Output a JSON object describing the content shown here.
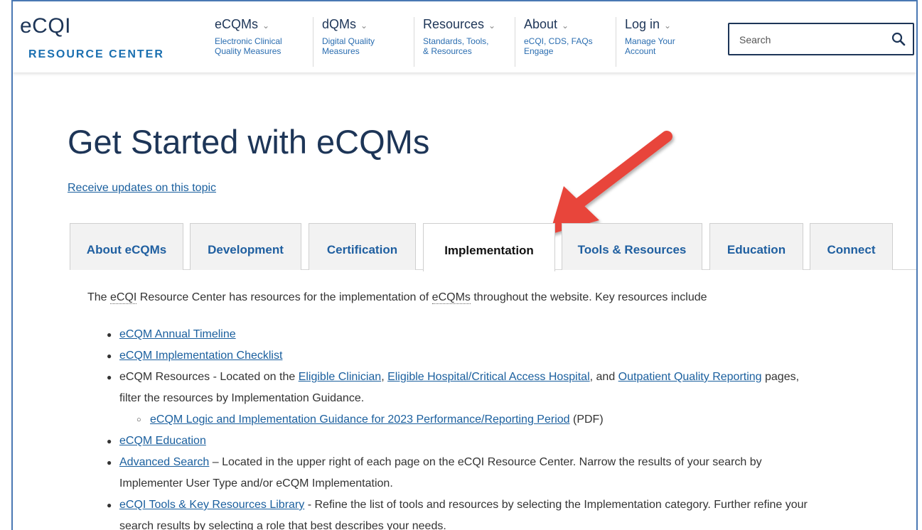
{
  "logo": {
    "top": "eCQI",
    "bottom": "RESOURCE CENTER"
  },
  "nav": [
    {
      "label": "eCQMs",
      "sub": "Electronic Clinical\nQuality Measures"
    },
    {
      "label": "dQMs",
      "sub": "Digital Quality\nMeasures"
    },
    {
      "label": "Resources",
      "sub": "Standards, Tools,\n& Resources"
    },
    {
      "label": "About",
      "sub": "eCQI, CDS, FAQs\nEngage"
    },
    {
      "label": "Log in",
      "sub": "Manage Your\nAccount"
    }
  ],
  "nav_caret": "⌄",
  "search": {
    "placeholder": "Search"
  },
  "page_title": "Get Started with eCQMs",
  "receive_updates": "Receive updates on this topic",
  "tabs": [
    {
      "label": "About eCQMs"
    },
    {
      "label": "Development"
    },
    {
      "label": "Certification"
    },
    {
      "label": "Implementation",
      "active": true
    },
    {
      "label": "Tools & Resources"
    },
    {
      "label": "Education"
    },
    {
      "label": "Connect"
    }
  ],
  "content": {
    "intro": {
      "t1": "The ",
      "abbr1": "eCQI",
      "t2": " Resource Center has resources for the implementation of ",
      "abbr2": "eCQMs",
      "t3": " throughout the website. Key resources include"
    },
    "items": {
      "timeline": "eCQM Annual Timeline",
      "checklist": "eCQM Implementation Checklist",
      "resources_prefix": "eCQM Resources - Located on the ",
      "eligible_clinician": "Eligible Clinician",
      "comma1": ", ",
      "eligible_hospital": "Eligible Hospital/Critical Access Hospital",
      "and": ", and ",
      "outpatient": "Outpatient Quality Reporting",
      "pages": " pages,",
      "resources_cont": "filter the resources by Implementation Guidance.",
      "logic_link": "eCQM Logic and Implementation Guidance for 2023 Performance/Reporting Period",
      "logic_suffix": " (PDF)",
      "education": "eCQM Education",
      "advanced_search": "Advanced Search",
      "advanced_text": " – Located in the upper right of each page on the eCQI Resource Center. Narrow the results of your search by",
      "advanced_cont": "Implementer User Type and/or eCQM Implementation.",
      "tools_library": "eCQI Tools & Key Resources Library",
      "tools_text": " - Refine the list of tools and resources by selecting the Implementation category. Further refine your",
      "tools_cont": "search results by selecting a role that best describes your needs."
    }
  },
  "colors": {
    "arrow": "#e8443a",
    "link": "#1a5f9e",
    "navy": "#1d3557",
    "frame": "#4a78b3"
  }
}
